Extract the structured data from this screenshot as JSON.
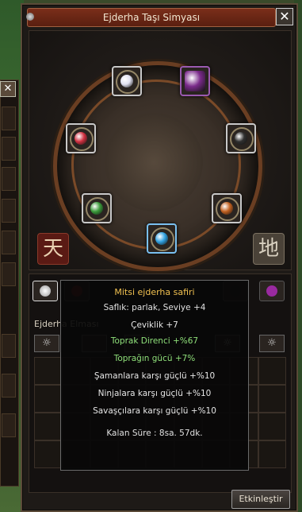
{
  "window": {
    "title": "Ejderha Taşı Simyası",
    "close_glyph": "✕"
  },
  "side_panel": {
    "close_glyph": "✕"
  },
  "glyphs": {
    "heaven": "天",
    "earth": "地"
  },
  "slots": [
    {
      "name": "slot-top-diamond",
      "gem_color": "#e0e0f0"
    },
    {
      "name": "slot-top-amethyst",
      "gem_color": "#7a2a8a"
    },
    {
      "name": "slot-left-ruby",
      "gem_color": "#d03040"
    },
    {
      "name": "slot-right-onyx",
      "gem_color": "#303030"
    },
    {
      "name": "slot-left-jade",
      "gem_color": "#3a9a3a"
    },
    {
      "name": "slot-right-garnet",
      "gem_color": "#c06020"
    },
    {
      "name": "slot-bottom-sapphire",
      "gem_color": "#30a0e0"
    }
  ],
  "lower": {
    "section_label": "Ejderha Elması",
    "icon_glyph": "☼"
  },
  "tooltip": {
    "title": "Mitsi ejderha safiri",
    "purity": "Saflık: parlak, Seviye +4",
    "stats": [
      {
        "text": "Çeviklik +7",
        "color": "#e6e6e6"
      },
      {
        "text": "Toprak Direnci +%67",
        "color": "#8fe07a"
      },
      {
        "text": "Toprağın gücü +7%",
        "color": "#8fe07a"
      },
      {
        "text": "Şamanlara karşı güçlü +%10",
        "color": "#e6e6e6"
      },
      {
        "text": "Ninjalara karşı güçlü +%10",
        "color": "#e6e6e6"
      },
      {
        "text": "Savaşçılara karşı güçlü +%10",
        "color": "#e6e6e6"
      }
    ],
    "remaining": "Kalan Süre : 8sa. 57dk."
  },
  "buttons": {
    "activate": "Etkinleştir"
  },
  "colors": {
    "title_gold": "#f0c050",
    "accent": "#7a2e1a"
  }
}
